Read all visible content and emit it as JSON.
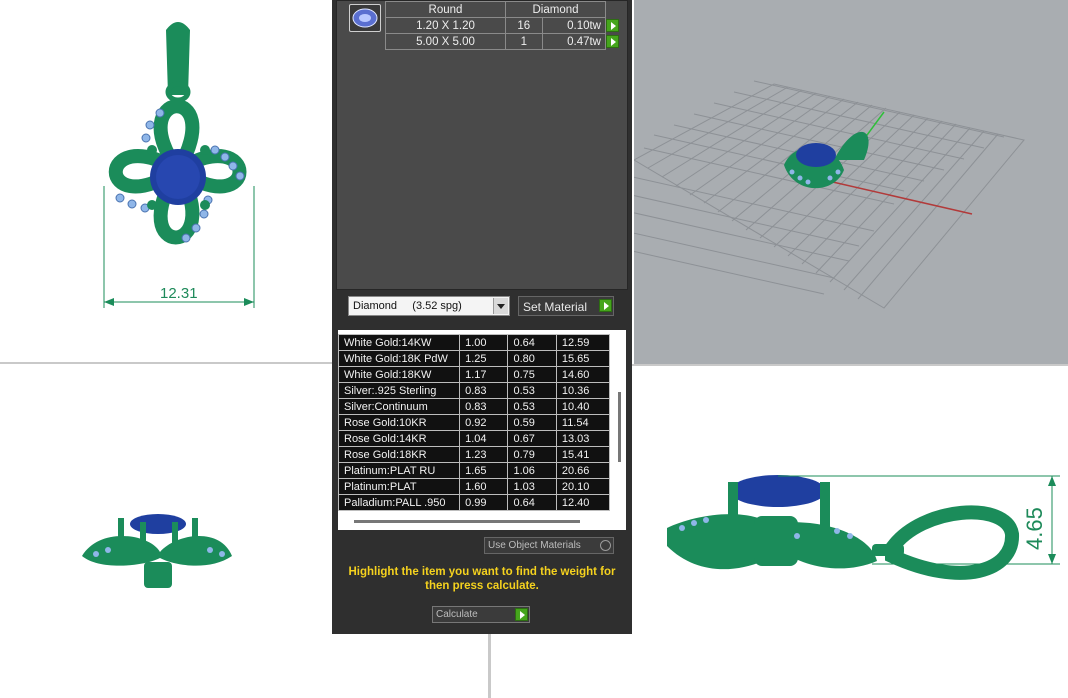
{
  "viewports": {
    "top_dimension": "12.31",
    "right_dimension": "4.65"
  },
  "stone_table": {
    "headers": [
      "Round",
      "Diamond"
    ],
    "rows": [
      {
        "size": "1.20 X 1.20",
        "count": "16",
        "weight": "0.10tw"
      },
      {
        "size": "5.00 X 5.00",
        "count": "1",
        "weight": "0.47tw"
      }
    ]
  },
  "material_select": {
    "value": "Diamond     (3.52 spg)"
  },
  "set_material_label": "Set Material",
  "metals": [
    {
      "name": "White Gold:14KW",
      "a": "1.00",
      "b": "0.64",
      "c": "12.59"
    },
    {
      "name": "White Gold:18K PdW",
      "a": "1.25",
      "b": "0.80",
      "c": "15.65"
    },
    {
      "name": "White Gold:18KW",
      "a": "1.17",
      "b": "0.75",
      "c": "14.60"
    },
    {
      "name": "Silver:.925 Sterling",
      "a": "0.83",
      "b": "0.53",
      "c": "10.36"
    },
    {
      "name": "Silver:Continuum",
      "a": "0.83",
      "b": "0.53",
      "c": "10.40"
    },
    {
      "name": "Rose Gold:10KR",
      "a": "0.92",
      "b": "0.59",
      "c": "11.54"
    },
    {
      "name": "Rose Gold:14KR",
      "a": "1.04",
      "b": "0.67",
      "c": "13.03"
    },
    {
      "name": "Rose Gold:18KR",
      "a": "1.23",
      "b": "0.79",
      "c": "15.41"
    },
    {
      "name": "Platinum:PLAT RU",
      "a": "1.65",
      "b": "1.06",
      "c": "20.66"
    },
    {
      "name": "Platinum:PLAT",
      "a": "1.60",
      "b": "1.03",
      "c": "20.10"
    },
    {
      "name": "Palladium:PALL .950",
      "a": "0.99",
      "b": "0.64",
      "c": "12.40"
    }
  ],
  "use_object_materials": "Use Object Materials",
  "hint": "Highlight the item you want to find the weight for then press calculate.",
  "calculate_label": "Calculate",
  "colors": {
    "model_green": "#1b8c5a",
    "stone_blue": "#1f3fa0",
    "accent_stone": "#8fb6e8",
    "button_green": "#45a51c",
    "hint_yellow": "#f5d21e"
  }
}
